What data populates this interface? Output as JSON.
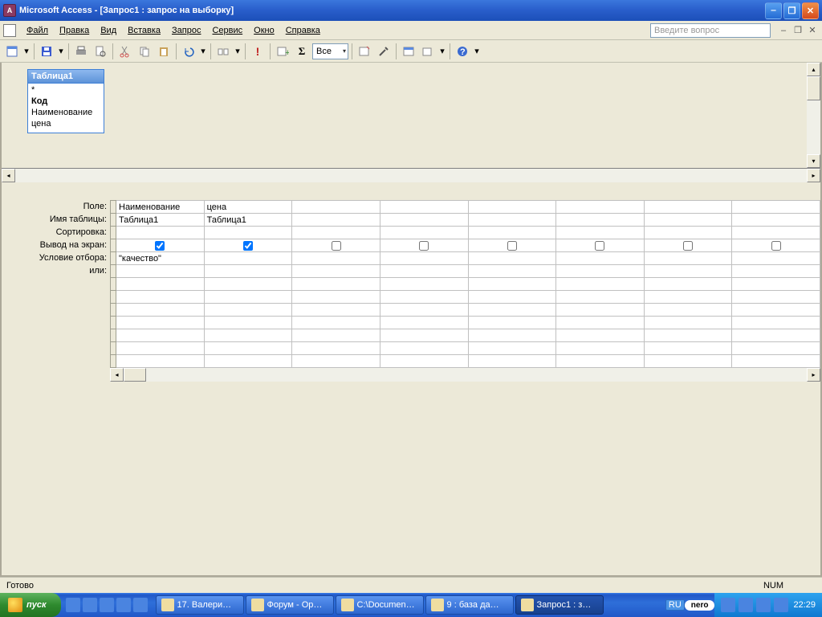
{
  "titlebar": {
    "app": "Microsoft Access",
    "doc": "[Запрос1 : запрос на выборку]"
  },
  "menubar": {
    "items": [
      "Файл",
      "Правка",
      "Вид",
      "Вставка",
      "Запрос",
      "Сервис",
      "Окно",
      "Справка"
    ],
    "help_placeholder": "Введите вопрос"
  },
  "toolbar": {
    "combo_value": "Все"
  },
  "source_table": {
    "name": "Таблица1",
    "star": "*",
    "fields": [
      "Код",
      "Наименование",
      "цена"
    ],
    "pk": "Код"
  },
  "design_grid": {
    "row_labels": [
      "Поле:",
      "Имя таблицы:",
      "Сортировка:",
      "Вывод на экран:",
      "Условие отбора:",
      "или:"
    ],
    "columns": [
      {
        "field": "Наименование",
        "table": "Таблица1",
        "sort": "",
        "show": true,
        "criteria": "\"качество\"",
        "or": ""
      },
      {
        "field": "цена",
        "table": "Таблица1",
        "sort": "",
        "show": true,
        "criteria": "",
        "or": ""
      },
      {
        "field": "",
        "table": "",
        "sort": "",
        "show": false,
        "criteria": "",
        "or": ""
      },
      {
        "field": "",
        "table": "",
        "sort": "",
        "show": false,
        "criteria": "",
        "or": ""
      },
      {
        "field": "",
        "table": "",
        "sort": "",
        "show": false,
        "criteria": "",
        "or": ""
      },
      {
        "field": "",
        "table": "",
        "sort": "",
        "show": false,
        "criteria": "",
        "or": ""
      },
      {
        "field": "",
        "table": "",
        "sort": "",
        "show": false,
        "criteria": "",
        "or": ""
      },
      {
        "field": "",
        "table": "",
        "sort": "",
        "show": false,
        "criteria": "",
        "or": ""
      }
    ]
  },
  "statusbar": {
    "ready": "Готово",
    "num": "NUM"
  },
  "taskbar": {
    "start": "пуск",
    "tasks": [
      {
        "label": "17. Валери…"
      },
      {
        "label": "Форум - Op…"
      },
      {
        "label": "C:\\Documen…"
      },
      {
        "label": "9 : база да…"
      },
      {
        "label": "Запрос1 : з…",
        "active": true
      }
    ],
    "lang": "RU",
    "nero": "nero",
    "clock": "22:29"
  }
}
